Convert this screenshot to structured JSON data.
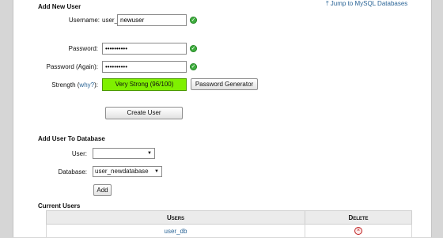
{
  "add_user": {
    "heading": "Add New User",
    "jump_link": "Jump to MySQL Databases",
    "username_label": "Username:",
    "username_prefix": "user_",
    "username_value": "newuser",
    "password_label": "Password:",
    "password_value": "••••••••••",
    "password_again_label": "Password (Again):",
    "password_again_value": "••••••••••",
    "strength_label_prefix": "Strength (",
    "strength_why": "why?",
    "strength_label_suffix": "):",
    "strength_value": "Very Strong (96/100)",
    "strength_percent": 96,
    "password_generator_button": "Password Generator",
    "create_user_button": "Create User"
  },
  "add_to_db": {
    "heading": "Add User To Database",
    "user_label": "User:",
    "user_selected": "",
    "database_label": "Database:",
    "database_selected": "user_newdatabase",
    "add_button": "Add"
  },
  "current_users": {
    "heading": "Current Users",
    "columns": [
      "Users",
      "Delete"
    ],
    "rows": [
      {
        "user": "user_db"
      }
    ]
  },
  "colors": {
    "strength_green": "#7ff000",
    "ok_green": "#3fae3f",
    "link_blue": "#2a6496",
    "delete_red": "#c02020"
  },
  "icons": {
    "valid": "check-circle-icon",
    "delete": "delete-circle-icon",
    "jump": "jump-arrow-icon"
  }
}
